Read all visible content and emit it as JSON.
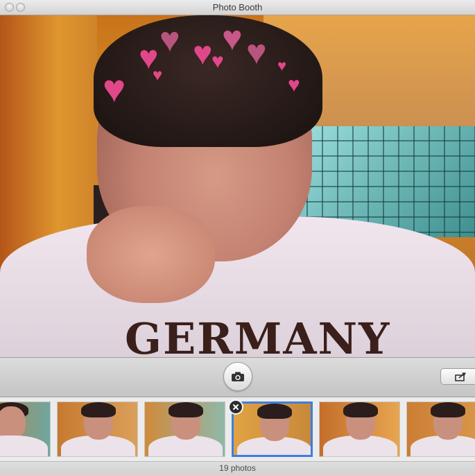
{
  "window": {
    "title": "Photo Booth"
  },
  "preview": {
    "shirt_print": "GERMANY",
    "effect": "hearts",
    "heart_color": "#e0488a"
  },
  "toolbar": {
    "take_photo_icon": "camera-icon",
    "share_icon": "share-icon"
  },
  "thumbnails": {
    "selected_index": 3,
    "items": [
      {
        "name": "photo-1"
      },
      {
        "name": "photo-2"
      },
      {
        "name": "photo-3"
      },
      {
        "name": "photo-4"
      },
      {
        "name": "photo-5"
      },
      {
        "name": "photo-6"
      }
    ]
  },
  "status": {
    "count_label": "19 photos"
  },
  "colors": {
    "selection_blue": "#3b7fe0"
  }
}
